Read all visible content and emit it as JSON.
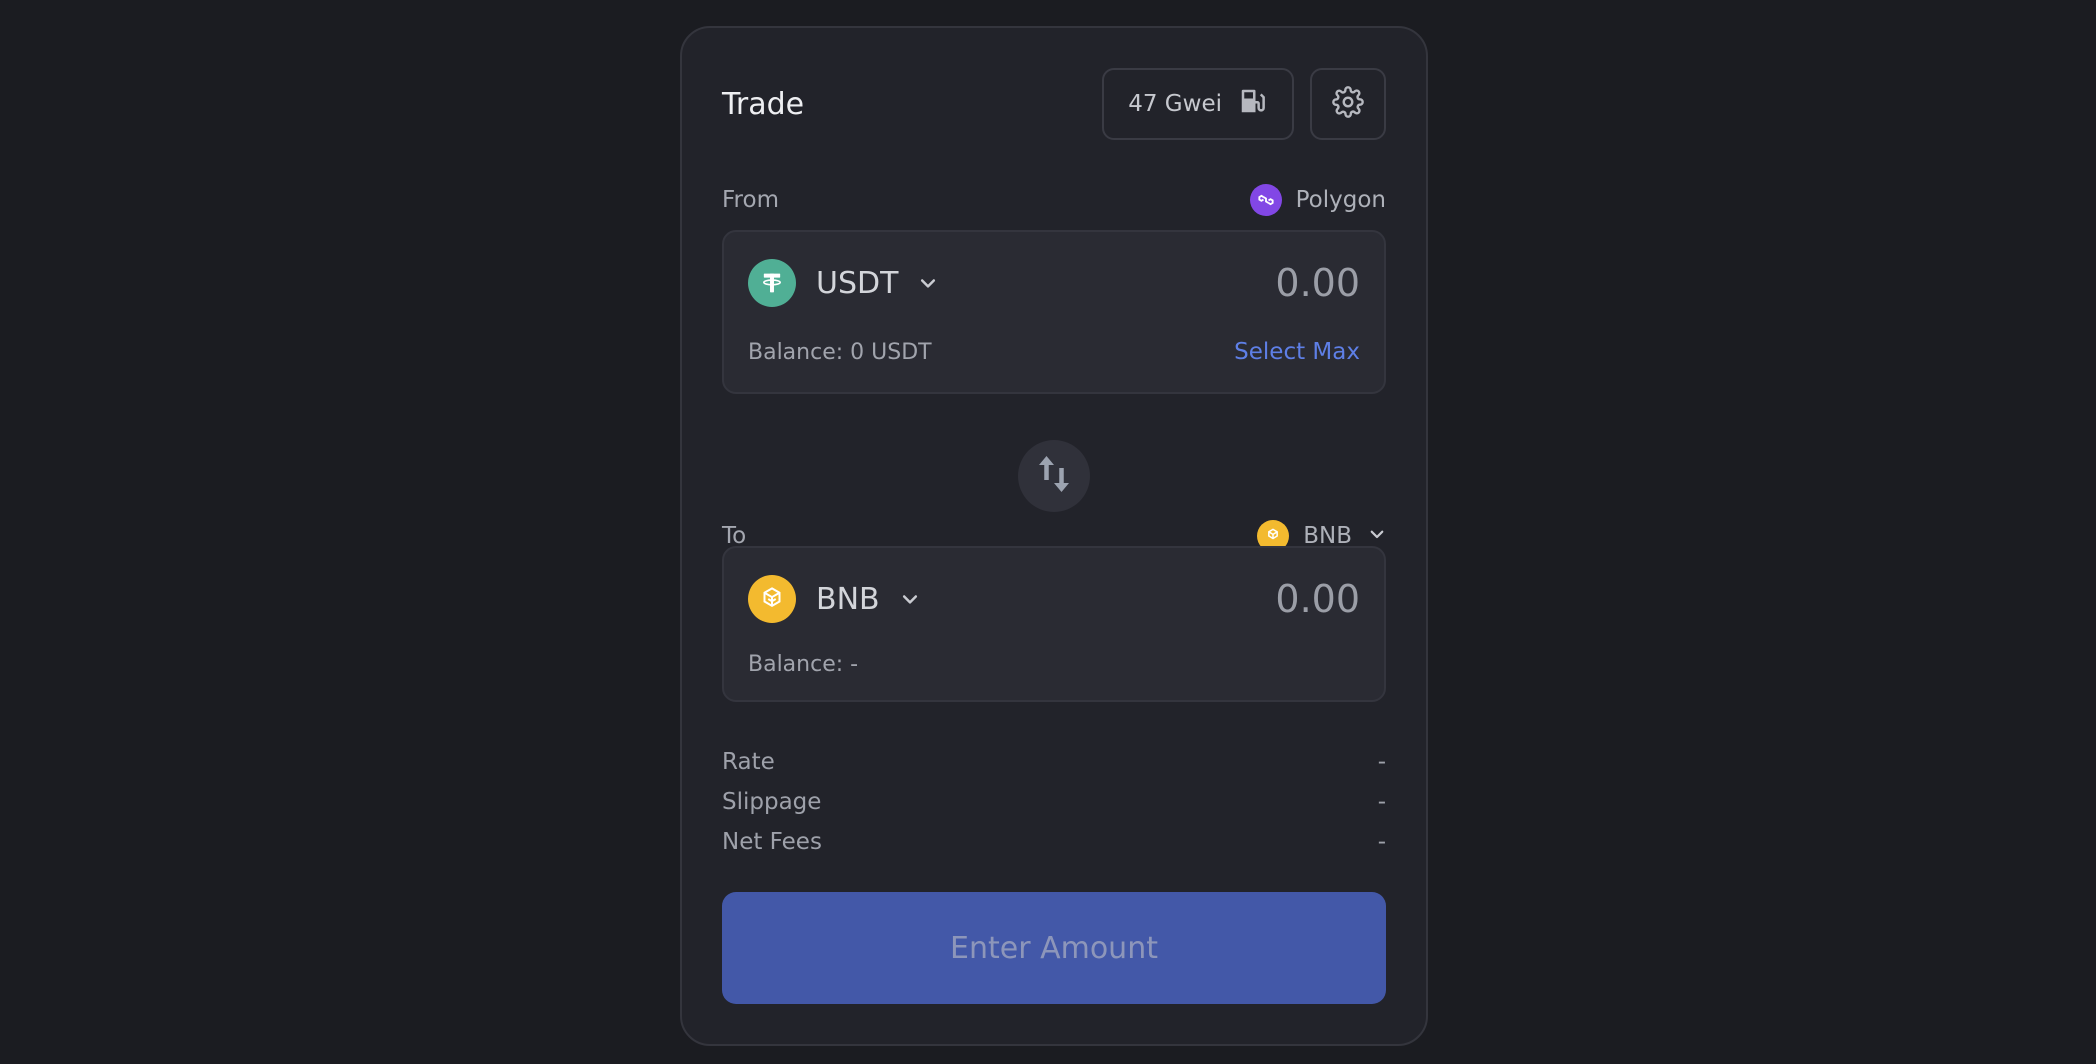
{
  "header": {
    "title": "Trade",
    "gas_label": "47 Gwei",
    "gas_icon": "gas-pump-icon",
    "settings_icon": "gear-icon"
  },
  "from": {
    "label": "From",
    "network": "Polygon",
    "network_icon": "polygon-icon",
    "token": "USDT",
    "token_icon": "tether-icon",
    "amount": "0.00",
    "balance": "Balance: 0 USDT",
    "select_max": "Select Max"
  },
  "swap": {
    "icon": "swap-arrows-icon"
  },
  "to": {
    "label": "To",
    "network": "BNB",
    "network_icon": "bnb-icon",
    "token": "BNB",
    "token_icon": "bnb-icon",
    "amount": "0.00",
    "balance": "Balance: -"
  },
  "info": [
    {
      "label": "Rate",
      "value": "-"
    },
    {
      "label": "Slippage",
      "value": "-"
    },
    {
      "label": "Net Fees",
      "value": "-"
    }
  ],
  "cta": {
    "label": "Enter Amount"
  },
  "colors": {
    "background": "#1b1c21",
    "card": "#22232a",
    "accent": "#4358a8",
    "link": "#5e7fe6",
    "usdt": "#50af95",
    "bnb": "#f3ba2f",
    "polygon": "#8247e5"
  }
}
